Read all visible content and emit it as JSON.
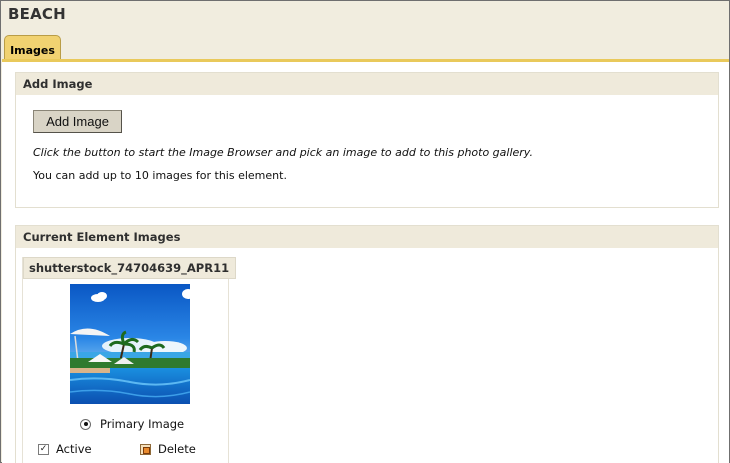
{
  "page": {
    "title": "BEACH"
  },
  "tabs": [
    {
      "label": "Images",
      "active": true
    }
  ],
  "add_image": {
    "header": "Add Image",
    "button_label": "Add Image",
    "hint": "Click the button to start the Image Browser and pick an image to add to this photo gallery.",
    "limit_text": "You can add up to 10 images for this element."
  },
  "current_images": {
    "header": "Current Element Images",
    "items": [
      {
        "name": "shutterstock_74704639_APR11",
        "primary_label": "Primary Image",
        "primary_selected": true,
        "active_label": "Active",
        "active_checked": true,
        "delete_label": "Delete",
        "delete_checked": false
      }
    ]
  },
  "colors": {
    "tab_active": "#f1d271",
    "panel_header": "#efeadb",
    "frame_bg": "#f1eddf"
  }
}
